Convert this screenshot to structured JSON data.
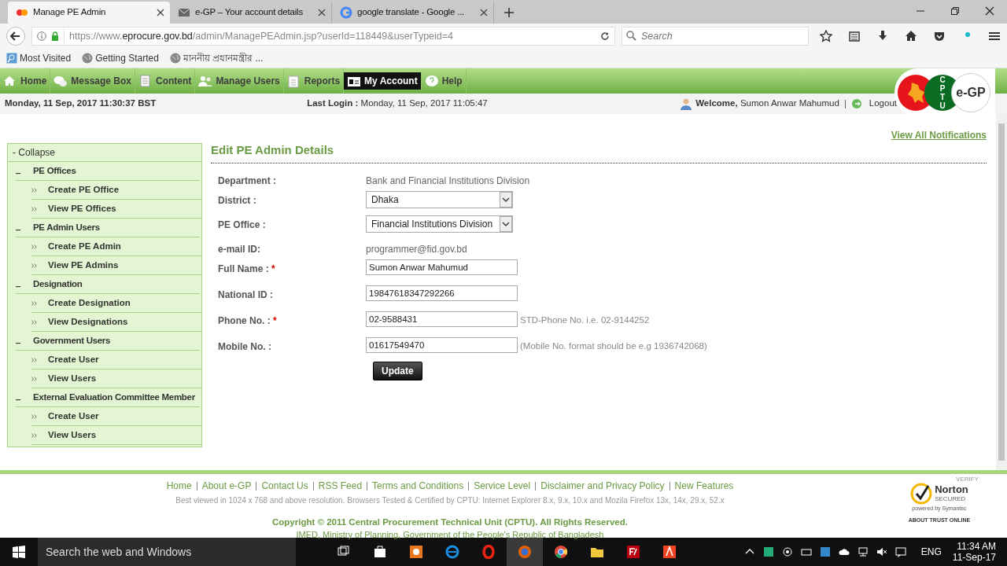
{
  "browser": {
    "tabs": [
      {
        "title": "Manage PE Admin",
        "selected": true
      },
      {
        "title": "e-GP – Your account details",
        "selected": false
      },
      {
        "title": "google translate - Google ...",
        "selected": false
      }
    ],
    "url_prefix": "https://www.",
    "url_host": "eprocure.gov.bd",
    "url_path": "/admin/ManagePEAdmin.jsp?userId=118449&userTypeid=4",
    "search": {
      "placeholder": "Search"
    },
    "bookmarks": [
      "Most Visited",
      "Getting Started",
      "মাননীয় প্রধানমন্ত্রীর ..."
    ]
  },
  "site": {
    "menu": [
      {
        "label": "Home",
        "selected": false
      },
      {
        "label": "Message Box",
        "selected": false
      },
      {
        "label": "Content",
        "selected": false
      },
      {
        "label": "Manage Users",
        "selected": false
      },
      {
        "label": "Reports",
        "selected": false
      },
      {
        "label": "My Account",
        "selected": true
      },
      {
        "label": "Help",
        "selected": false
      }
    ],
    "date": "Monday, 11 Sep, 2017 11:30:37 BST",
    "last_login_label": "Last Login :",
    "last_login": "Monday, 11 Sep, 2017 11:05:47",
    "welcome_label": "Welcome,",
    "user_name": "Sumon Anwar Mahumud",
    "logout": "Logout",
    "logo": {
      "letters": [
        "C",
        "P",
        "T",
        "U"
      ],
      "name": "e-GP"
    },
    "notifications": "View All Notifications",
    "sidebar": {
      "collapse": "- Collapse",
      "groups": [
        {
          "title": "PE Offices",
          "items": [
            "Create PE Office",
            "View PE Offices"
          ]
        },
        {
          "title": "PE Admin Users",
          "items": [
            "Create PE Admin",
            "View PE Admins"
          ]
        },
        {
          "title": "Designation",
          "items": [
            "Create Designation",
            "View Designations"
          ]
        },
        {
          "title": "Government Users",
          "items": [
            "Create User",
            "View Users"
          ]
        },
        {
          "title": "External Evaluation Committee Member",
          "items": [
            "Create User",
            "View Users"
          ]
        }
      ]
    },
    "form": {
      "title": "Edit PE Admin Details",
      "fields": [
        {
          "label": "Department :",
          "kind": "static",
          "value": "Bank and Financial Institutions Division"
        },
        {
          "label": "District :",
          "kind": "select",
          "value": "Dhaka"
        },
        {
          "label": "PE Office :",
          "kind": "select",
          "value": "Financial Institutions Division"
        },
        {
          "label": "e-mail ID:",
          "kind": "static",
          "value": "programmer@fid.gov.bd"
        },
        {
          "label": "Full Name :",
          "required_mark": "*",
          "kind": "input",
          "value": "Sumon Anwar Mahumud"
        },
        {
          "label": "National ID :",
          "kind": "input",
          "value": "19847618347292266"
        },
        {
          "label": "Phone No. :",
          "required_mark": "*",
          "kind": "input",
          "value": "02-9588431",
          "hint": "STD-Phone No. i.e. 02-9144252"
        },
        {
          "label": "Mobile No. :",
          "kind": "input",
          "value": "01617549470",
          "hint": "(Mobile No. format should be e.g 1936742068)"
        }
      ],
      "button": "Update"
    },
    "footer": {
      "links": [
        "Home",
        "About e-GP",
        "Contact Us",
        "RSS Feed",
        "Terms and Conditions",
        "Service Level",
        "Disclaimer and Privacy Policy",
        "New Features"
      ],
      "browsers_note": "Best viewed in 1024 x 768 and above resolution. Browsers Tested & Certified by CPTU: Internet Explorer 8.x, 9.x, 10.x and Mozila Firefox 13x, 14x, 29.x, 52.x",
      "copyright": "Copyright © 2011 Central Procurement Technical Unit (CPTU). All Rights Reserved.",
      "ministry": "IMED, Ministry of Planning, Government of the People's Republic of Bangladesh",
      "norton": {
        "verify": "VERIFY",
        "brand": "Norton",
        "secured": "SECURED",
        "powered": "powered by Symantec",
        "about": "ABOUT TRUST ONLINE"
      }
    }
  },
  "taskbar": {
    "search_placeholder": "Search the web and Windows",
    "language": "ENG",
    "time": "11:34 AM",
    "date": "11-Sep-17"
  }
}
